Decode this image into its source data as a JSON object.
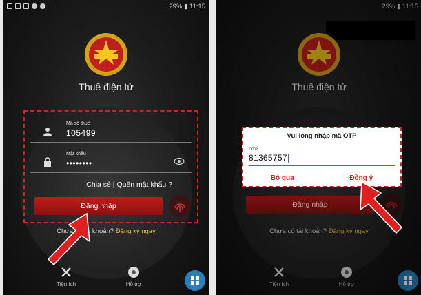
{
  "left_phone": {
    "status": {
      "right_text": "    29% ▮ 11:15"
    },
    "app_title": "Thuế điện tử",
    "fields": {
      "tax": {
        "label": "Mã số thuế",
        "value": "105499"
      },
      "password": {
        "label": "Mật khẩu",
        "value": "••••••••"
      }
    },
    "links_text": "Chia sẻ  | Quên mật khẩu ?",
    "login_button": "Đăng nhập",
    "register_prefix": "Chưa có tài khoản?",
    "register_link": "Đăng ký ngay",
    "nav": [
      {
        "label": "Tiện ích",
        "icon": "tools-icon"
      },
      {
        "label": "Hỗ trợ",
        "icon": "support-icon"
      }
    ],
    "fab_icon": "grid-icon"
  },
  "right_phone": {
    "status": {
      "right_text": "29% ▮ 11:15"
    },
    "app_title": "Thuế điện tử",
    "otp_dialog": {
      "title": "Vui lòng nhập mã OTP",
      "label": "OTP",
      "value": "81365757",
      "cancel": "Bỏ qua",
      "confirm": "Đồng ý"
    },
    "login_button": "Đăng nhập",
    "register_prefix": "Chưa có tài khoản?",
    "register_link": "Đăng ký ngay",
    "nav": [
      {
        "label": "Tiện ích",
        "icon": "tools-icon"
      },
      {
        "label": "Hỗ trợ",
        "icon": "support-icon"
      }
    ],
    "fab_icon": "grid-icon"
  },
  "colors": {
    "accent_red": "#d81e1e",
    "link_yellow": "#e8c338",
    "fab_blue": "#2d7fb8"
  }
}
